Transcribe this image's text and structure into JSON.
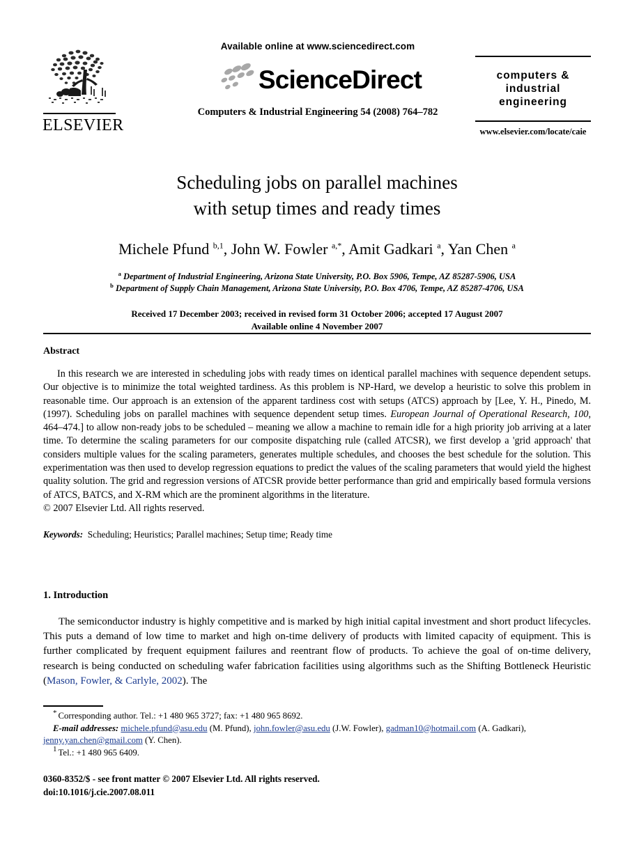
{
  "masthead": {
    "publisher_logo_text": "ELSEVIER",
    "publisher_logo_icon": "elsevier-tree-logo",
    "available_online": "Available online at www.sciencedirect.com",
    "sciencedirect_wordmark": "ScienceDirect",
    "sciencedirect_swoosh_icon": "sciencedirect-swoosh-icon",
    "journal_citation": "Computers & Industrial Engineering 54 (2008) 764–782",
    "journal_badge_title_line1": "computers &",
    "journal_badge_title_line2": "industrial",
    "journal_badge_title_line3": "engineering",
    "journal_badge_url": "www.elsevier.com/locate/caie"
  },
  "article": {
    "title_line1": "Scheduling jobs on parallel machines",
    "title_line2": "with setup times and ready times",
    "authors": [
      {
        "name": "Michele Pfund",
        "marks": "b,1",
        "separator": ", "
      },
      {
        "name": "John W. Fowler",
        "marks": "a,*",
        "separator": ", "
      },
      {
        "name": "Amit Gadkari",
        "marks": "a",
        "separator": ", "
      },
      {
        "name": "Yan Chen",
        "marks": "a",
        "separator": ""
      }
    ],
    "affiliations": [
      {
        "mark": "a",
        "text": "Department of Industrial Engineering, Arizona State University, P.O. Box 5906, Tempe, AZ 85287-5906, USA"
      },
      {
        "mark": "b",
        "text": "Department of Supply Chain Management, Arizona State University, P.O. Box 4706, Tempe, AZ 85287-4706, USA"
      }
    ],
    "dates_line1": "Received 17 December 2003; received in revised form 31 October 2006; accepted 17 August 2007",
    "dates_line2": "Available online 4 November 2007"
  },
  "abstract": {
    "heading": "Abstract",
    "paragraph_part1": "In this research we are interested in scheduling jobs with ready times on identical parallel machines with sequence dependent setups. Our objective is to minimize the total weighted tardiness. As this problem is NP-Hard, we develop a heuristic to solve this problem in reasonable time. Our approach is an extension of the apparent tardiness cost with setups (ATCS) approach by [Lee, Y. H., Pinedo, M. (1997). Scheduling jobs on parallel machines with sequence dependent setup times. ",
    "citation_italic": "European Journal of Operational Research, 100",
    "paragraph_part2": ", 464–474.] to allow non-ready jobs to be scheduled – meaning we allow a machine to remain idle for a high priority job arriving at a later time. To determine the scaling parameters for our composite dispatching rule (called ATCSR), we first develop a 'grid approach' that considers multiple values for the scaling parameters, generates multiple schedules, and chooses the best schedule for the solution. This experimentation was then used to develop regression equations to predict the values of the scaling parameters that would yield the highest quality solution. The grid and regression versions of ATCSR provide better performance than grid and empirically based formula versions of ATCS, BATCS, and X-RM which are the prominent algorithms in the literature.",
    "copyright": "© 2007 Elsevier Ltd. All rights reserved.",
    "keywords_label": "Keywords:",
    "keywords_value": "Scheduling; Heuristics; Parallel machines; Setup time; Ready time"
  },
  "introduction": {
    "heading": "1. Introduction",
    "paragraph_part1": "The semiconductor industry is highly competitive and is marked by high initial capital investment and short product lifecycles. This puts a demand of low time to market and high on-time delivery of products with limited capacity of equipment. This is further complicated by frequent equipment failures and reentrant flow of products. To achieve the goal of on-time delivery, research is being conducted on scheduling wafer fabrication facilities using algorithms such as the Shifting Bottleneck Heuristic (",
    "citation_link": "Mason, Fowler, & Carlyle, 2002",
    "paragraph_part2": "). The"
  },
  "footnotes": {
    "corresponding_marker": "*",
    "corresponding_text": "Corresponding author. Tel.: +1 480 965 3727; fax: +1 480 965 8692.",
    "email_label": "E-mail addresses:",
    "emails": [
      {
        "address": "michele.pfund@asu.edu",
        "owner": "(M. Pfund),",
        "trailing": " "
      },
      {
        "address": "john.fowler@asu.edu",
        "owner": "(J.W. Fowler),",
        "trailing": " "
      },
      {
        "address": "gadman10@hotmail.com",
        "owner": "(A. Gadkari),",
        "trailing": " "
      },
      {
        "address": "jenny.yan.chen@gmail.com",
        "owner": "(Y. Chen).",
        "trailing": ""
      }
    ],
    "tel_marker": "1",
    "tel_text": "Tel.: +1 480 965 6409."
  },
  "publisher_footer": {
    "issn_line": "0360-8352/$ - see front matter © 2007 Elsevier Ltd. All rights reserved.",
    "doi_line": "doi:10.1016/j.cie.2007.08.011"
  },
  "colors": {
    "link": "#1a3a8f",
    "text": "#000000",
    "background": "#ffffff",
    "swoosh": "#a8a8a8"
  }
}
